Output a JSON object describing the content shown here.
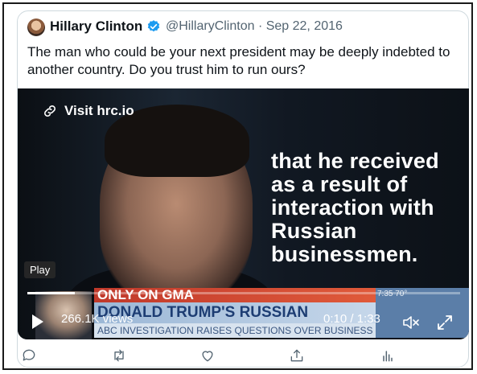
{
  "tweet": {
    "author_name": "Hillary Clinton",
    "handle_date": "@HillaryClinton · Sep 22, 2016",
    "text": "The man who could be your next president may be deeply indebted to another country. Do you trust him to run ours?"
  },
  "video": {
    "link_label": "Visit hrc.io",
    "overlay_text": "that he received as a result of interaction with Russian businessmen.",
    "play_tooltip": "Play",
    "views": "266.1K views",
    "time": "0:10 / 1:33",
    "progress": 0.11,
    "lower_third": {
      "top": "ONLY ON GMA",
      "main": "DONALD TRUMP'S RUSSIAN CONNECTIONS",
      "sub": "ABC INVESTIGATION RAISES QUESTIONS OVER BUSINESS DEALINGS",
      "clock": "7:35  70°"
    }
  },
  "actions": [
    "reply-icon",
    "retweet-icon",
    "like-icon",
    "share-icon",
    "analytics-icon"
  ],
  "colors": {
    "verified": "#1d9bf0",
    "muted": "#536471"
  }
}
